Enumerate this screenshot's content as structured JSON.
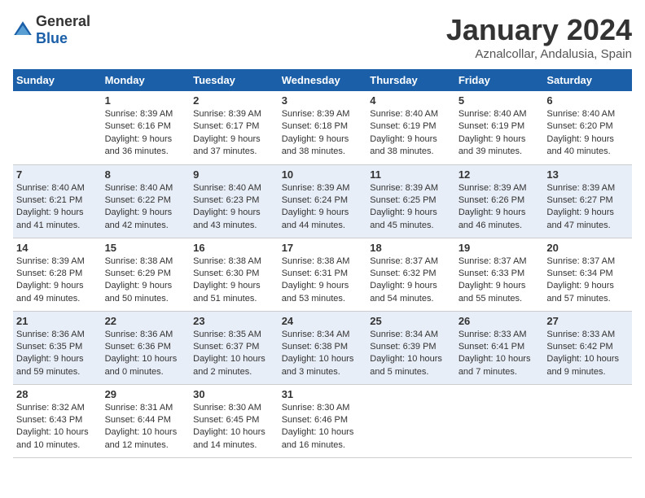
{
  "logo": {
    "text_general": "General",
    "text_blue": "Blue"
  },
  "header": {
    "title": "January 2024",
    "subtitle": "Aznalcollar, Andalusia, Spain"
  },
  "weekdays": [
    "Sunday",
    "Monday",
    "Tuesday",
    "Wednesday",
    "Thursday",
    "Friday",
    "Saturday"
  ],
  "weeks": [
    {
      "days": [
        {
          "num": "",
          "lines": []
        },
        {
          "num": "1",
          "lines": [
            "Sunrise: 8:39 AM",
            "Sunset: 6:16 PM",
            "Daylight: 9 hours",
            "and 36 minutes."
          ]
        },
        {
          "num": "2",
          "lines": [
            "Sunrise: 8:39 AM",
            "Sunset: 6:17 PM",
            "Daylight: 9 hours",
            "and 37 minutes."
          ]
        },
        {
          "num": "3",
          "lines": [
            "Sunrise: 8:39 AM",
            "Sunset: 6:18 PM",
            "Daylight: 9 hours",
            "and 38 minutes."
          ]
        },
        {
          "num": "4",
          "lines": [
            "Sunrise: 8:40 AM",
            "Sunset: 6:19 PM",
            "Daylight: 9 hours",
            "and 38 minutes."
          ]
        },
        {
          "num": "5",
          "lines": [
            "Sunrise: 8:40 AM",
            "Sunset: 6:19 PM",
            "Daylight: 9 hours",
            "and 39 minutes."
          ]
        },
        {
          "num": "6",
          "lines": [
            "Sunrise: 8:40 AM",
            "Sunset: 6:20 PM",
            "Daylight: 9 hours",
            "and 40 minutes."
          ]
        }
      ]
    },
    {
      "days": [
        {
          "num": "7",
          "lines": [
            "Sunrise: 8:40 AM",
            "Sunset: 6:21 PM",
            "Daylight: 9 hours",
            "and 41 minutes."
          ]
        },
        {
          "num": "8",
          "lines": [
            "Sunrise: 8:40 AM",
            "Sunset: 6:22 PM",
            "Daylight: 9 hours",
            "and 42 minutes."
          ]
        },
        {
          "num": "9",
          "lines": [
            "Sunrise: 8:40 AM",
            "Sunset: 6:23 PM",
            "Daylight: 9 hours",
            "and 43 minutes."
          ]
        },
        {
          "num": "10",
          "lines": [
            "Sunrise: 8:39 AM",
            "Sunset: 6:24 PM",
            "Daylight: 9 hours",
            "and 44 minutes."
          ]
        },
        {
          "num": "11",
          "lines": [
            "Sunrise: 8:39 AM",
            "Sunset: 6:25 PM",
            "Daylight: 9 hours",
            "and 45 minutes."
          ]
        },
        {
          "num": "12",
          "lines": [
            "Sunrise: 8:39 AM",
            "Sunset: 6:26 PM",
            "Daylight: 9 hours",
            "and 46 minutes."
          ]
        },
        {
          "num": "13",
          "lines": [
            "Sunrise: 8:39 AM",
            "Sunset: 6:27 PM",
            "Daylight: 9 hours",
            "and 47 minutes."
          ]
        }
      ]
    },
    {
      "days": [
        {
          "num": "14",
          "lines": [
            "Sunrise: 8:39 AM",
            "Sunset: 6:28 PM",
            "Daylight: 9 hours",
            "and 49 minutes."
          ]
        },
        {
          "num": "15",
          "lines": [
            "Sunrise: 8:38 AM",
            "Sunset: 6:29 PM",
            "Daylight: 9 hours",
            "and 50 minutes."
          ]
        },
        {
          "num": "16",
          "lines": [
            "Sunrise: 8:38 AM",
            "Sunset: 6:30 PM",
            "Daylight: 9 hours",
            "and 51 minutes."
          ]
        },
        {
          "num": "17",
          "lines": [
            "Sunrise: 8:38 AM",
            "Sunset: 6:31 PM",
            "Daylight: 9 hours",
            "and 53 minutes."
          ]
        },
        {
          "num": "18",
          "lines": [
            "Sunrise: 8:37 AM",
            "Sunset: 6:32 PM",
            "Daylight: 9 hours",
            "and 54 minutes."
          ]
        },
        {
          "num": "19",
          "lines": [
            "Sunrise: 8:37 AM",
            "Sunset: 6:33 PM",
            "Daylight: 9 hours",
            "and 55 minutes."
          ]
        },
        {
          "num": "20",
          "lines": [
            "Sunrise: 8:37 AM",
            "Sunset: 6:34 PM",
            "Daylight: 9 hours",
            "and 57 minutes."
          ]
        }
      ]
    },
    {
      "days": [
        {
          "num": "21",
          "lines": [
            "Sunrise: 8:36 AM",
            "Sunset: 6:35 PM",
            "Daylight: 9 hours",
            "and 59 minutes."
          ]
        },
        {
          "num": "22",
          "lines": [
            "Sunrise: 8:36 AM",
            "Sunset: 6:36 PM",
            "Daylight: 10 hours",
            "and 0 minutes."
          ]
        },
        {
          "num": "23",
          "lines": [
            "Sunrise: 8:35 AM",
            "Sunset: 6:37 PM",
            "Daylight: 10 hours",
            "and 2 minutes."
          ]
        },
        {
          "num": "24",
          "lines": [
            "Sunrise: 8:34 AM",
            "Sunset: 6:38 PM",
            "Daylight: 10 hours",
            "and 3 minutes."
          ]
        },
        {
          "num": "25",
          "lines": [
            "Sunrise: 8:34 AM",
            "Sunset: 6:39 PM",
            "Daylight: 10 hours",
            "and 5 minutes."
          ]
        },
        {
          "num": "26",
          "lines": [
            "Sunrise: 8:33 AM",
            "Sunset: 6:41 PM",
            "Daylight: 10 hours",
            "and 7 minutes."
          ]
        },
        {
          "num": "27",
          "lines": [
            "Sunrise: 8:33 AM",
            "Sunset: 6:42 PM",
            "Daylight: 10 hours",
            "and 9 minutes."
          ]
        }
      ]
    },
    {
      "days": [
        {
          "num": "28",
          "lines": [
            "Sunrise: 8:32 AM",
            "Sunset: 6:43 PM",
            "Daylight: 10 hours",
            "and 10 minutes."
          ]
        },
        {
          "num": "29",
          "lines": [
            "Sunrise: 8:31 AM",
            "Sunset: 6:44 PM",
            "Daylight: 10 hours",
            "and 12 minutes."
          ]
        },
        {
          "num": "30",
          "lines": [
            "Sunrise: 8:30 AM",
            "Sunset: 6:45 PM",
            "Daylight: 10 hours",
            "and 14 minutes."
          ]
        },
        {
          "num": "31",
          "lines": [
            "Sunrise: 8:30 AM",
            "Sunset: 6:46 PM",
            "Daylight: 10 hours",
            "and 16 minutes."
          ]
        },
        {
          "num": "",
          "lines": []
        },
        {
          "num": "",
          "lines": []
        },
        {
          "num": "",
          "lines": []
        }
      ]
    }
  ]
}
